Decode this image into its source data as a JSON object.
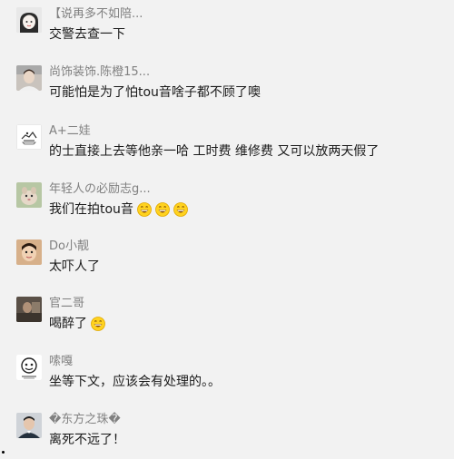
{
  "comments": [
    {
      "username": "【说再多不如陪...",
      "text": "交警去查一下",
      "avatar_icon": "avatar-cartoon-girl",
      "emoji_icons": []
    },
    {
      "username": "尚饰装饰.陈橙15...",
      "text": "可能怕是为了怕tou音啥子都不顾了噢",
      "avatar_icon": "avatar-person-photo",
      "emoji_icons": []
    },
    {
      "username": "A+二娃",
      "text": "的士直接上去等他亲一哈  工时费 维修费 又可以放两天假了",
      "avatar_icon": "avatar-sketch-drawing",
      "emoji_icons": []
    },
    {
      "username": "年轻人の必励志g...",
      "text": "我们在拍tou音",
      "avatar_icon": "avatar-pet-photo",
      "emoji_icons": [
        "grinning-face-icon",
        "grinning-face-icon",
        "grinning-face-icon"
      ]
    },
    {
      "username": "Do小靓",
      "text": "太吓人了",
      "avatar_icon": "avatar-child-photo",
      "emoji_icons": []
    },
    {
      "username": "官二哥",
      "text": "喝醉了",
      "avatar_icon": "avatar-dark-photo",
      "emoji_icons": [
        "grinning-face-icon"
      ]
    },
    {
      "username": "嗦嘎",
      "text": "坐等下文，应该会有处理的。。",
      "avatar_icon": "avatar-cartoon-sketch",
      "emoji_icons": []
    },
    {
      "username": "�东方之珠�",
      "text": "离死不远了！",
      "avatar_icon": "avatar-man-photo",
      "emoji_icons": []
    }
  ],
  "colors": {
    "background": "#f2f2f2",
    "username": "#808080",
    "text": "#1a1a1a",
    "emoji_fill": "#ffd21f"
  }
}
